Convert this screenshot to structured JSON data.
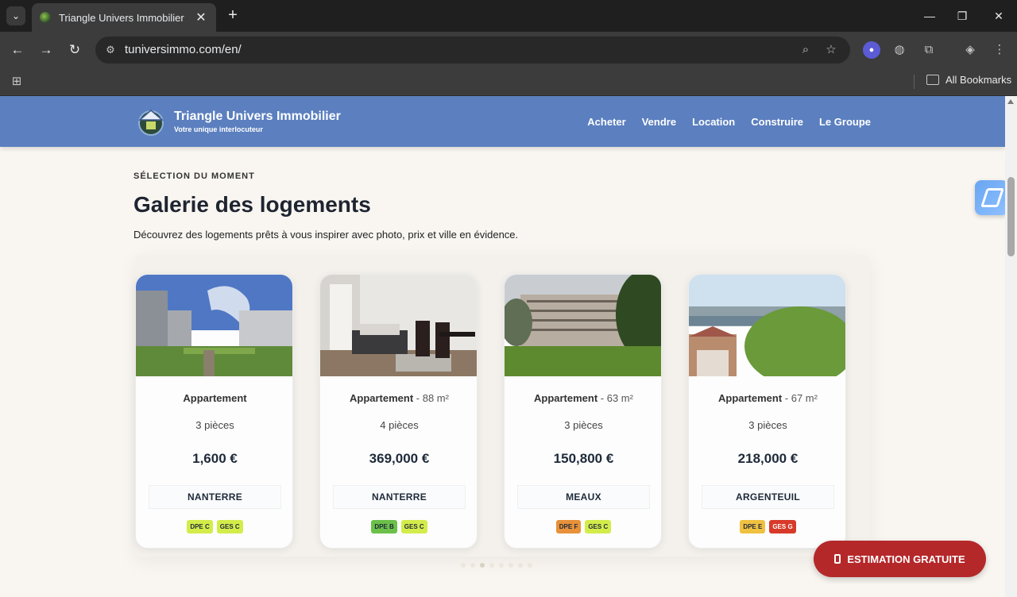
{
  "browser": {
    "tab_menu_icon": "chevron-down-icon",
    "tab_title": "Triangle Univers Immobilier",
    "tab_close": "✕",
    "new_tab": "+",
    "window_controls": [
      "—",
      "❐",
      "✕"
    ],
    "url": "tuniversimmo.com/en/",
    "bookmarks_label": "All Bookmarks"
  },
  "site": {
    "brand_name": "Triangle Univers Immobilier",
    "brand_tagline": "Votre unique interlocuteur",
    "nav": [
      {
        "label": "Acheter"
      },
      {
        "label": "Vendre"
      },
      {
        "label": "Location"
      },
      {
        "label": "Construire"
      },
      {
        "label": "Le Groupe"
      }
    ],
    "colors": {
      "header": "#5b7fbf",
      "cta": "#b5282a",
      "background": "#f9f6f1"
    }
  },
  "section": {
    "eyebrow": "SÉLECTION DU MOMENT",
    "title": "Galerie des logements",
    "subtitle": "Découvrez des logements prêts à vous inspirer avec photo, prix et ville en évidence."
  },
  "listings": [
    {
      "type": "Appartement",
      "area": "",
      "rooms": "3 pièces",
      "price": "1,600 €",
      "city": "NANTERRE",
      "badges": [
        {
          "label": "DPE C",
          "color": "#d4ec4a"
        },
        {
          "label": "GES C",
          "color": "#d4ec4a"
        }
      ]
    },
    {
      "type": "Appartement",
      "area": " - 88 m²",
      "rooms": "4 pièces",
      "price": "369,000 €",
      "city": "NANTERRE",
      "badges": [
        {
          "label": "DPE B",
          "color": "#6cc04a"
        },
        {
          "label": "GES C",
          "color": "#d4ec4a"
        }
      ]
    },
    {
      "type": "Appartement",
      "area": " - 63 m²",
      "rooms": "3 pièces",
      "price": "150,800 €",
      "city": "MEAUX",
      "badges": [
        {
          "label": "DPE F",
          "color": "#e8913a"
        },
        {
          "label": "GES C",
          "color": "#d4ec4a"
        }
      ]
    },
    {
      "type": "Appartement",
      "area": " - 67 m²",
      "rooms": "3 pièces",
      "price": "218,000 €",
      "city": "ARGENTEUIL",
      "badges": [
        {
          "label": "DPE E",
          "color": "#f0c040"
        },
        {
          "label": "GES G",
          "color": "#d83a2a"
        }
      ]
    }
  ],
  "carousel": {
    "dot_count": 8,
    "active_dot": 2
  },
  "cta": {
    "label": "ESTIMATION GRATUITE"
  }
}
